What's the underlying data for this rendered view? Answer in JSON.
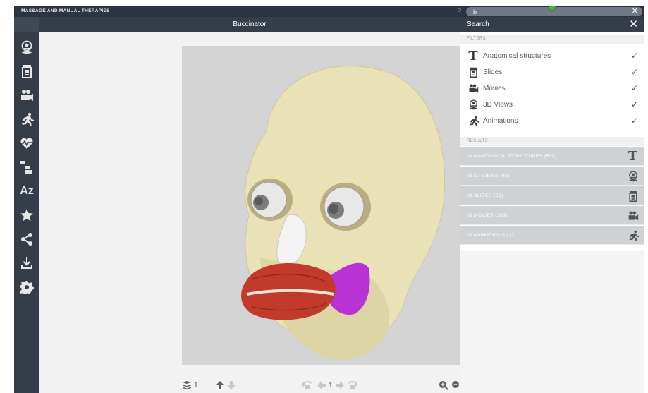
{
  "app": {
    "title": "MASSAGE AND MANUAL THERAPIES"
  },
  "topbar": {
    "help": "?",
    "search_value": "b",
    "clear": "✕"
  },
  "viewer": {
    "title": "Buccinator",
    "bottom": {
      "layers_count": "1",
      "page": "1"
    }
  },
  "panel": {
    "title": "Search",
    "close": "✕",
    "filters_label": "FILTERS",
    "filters": [
      {
        "label": "Anatomical structures",
        "icon": "text-T-icon",
        "checked": "✓"
      },
      {
        "label": "Slides",
        "icon": "slides-icon",
        "checked": "✓"
      },
      {
        "label": "Movies",
        "icon": "movies-icon",
        "checked": "✓"
      },
      {
        "label": "3D Views",
        "icon": "3d-views-icon",
        "checked": "✓"
      },
      {
        "label": "Animations",
        "icon": "animations-icon",
        "checked": "✓"
      }
    ],
    "results_label": "RESULTS",
    "results": [
      {
        "label": "IN ANATOMICAL STRUCTURES (539)",
        "icon": "text-T-icon"
      },
      {
        "label": "IN 3D VIEWS (93)",
        "icon": "3d-views-icon"
      },
      {
        "label": "IN SLIDES (56)",
        "icon": "slides-icon"
      },
      {
        "label": "IN MOVIES (163)",
        "icon": "movies-icon"
      },
      {
        "label": "IN ANIMATIONS (11)",
        "icon": "animations-icon"
      }
    ]
  },
  "sidebar": {
    "items": [
      {
        "name": "3d-views-icon"
      },
      {
        "name": "slides-icon"
      },
      {
        "name": "movies-icon"
      },
      {
        "name": "animations-icon"
      },
      {
        "name": "heartbeat-icon"
      },
      {
        "name": "hierarchy-icon"
      },
      {
        "name": "az-index-icon",
        "text": "Az"
      },
      {
        "name": "star-icon"
      },
      {
        "name": "share-icon"
      },
      {
        "name": "download-icon"
      },
      {
        "name": "settings-icon"
      }
    ]
  },
  "colors": {
    "dark": "#343d48",
    "topbar": "#2b3440",
    "status_dot": "#3dbb3d",
    "result_row": "#cfd2d5"
  }
}
